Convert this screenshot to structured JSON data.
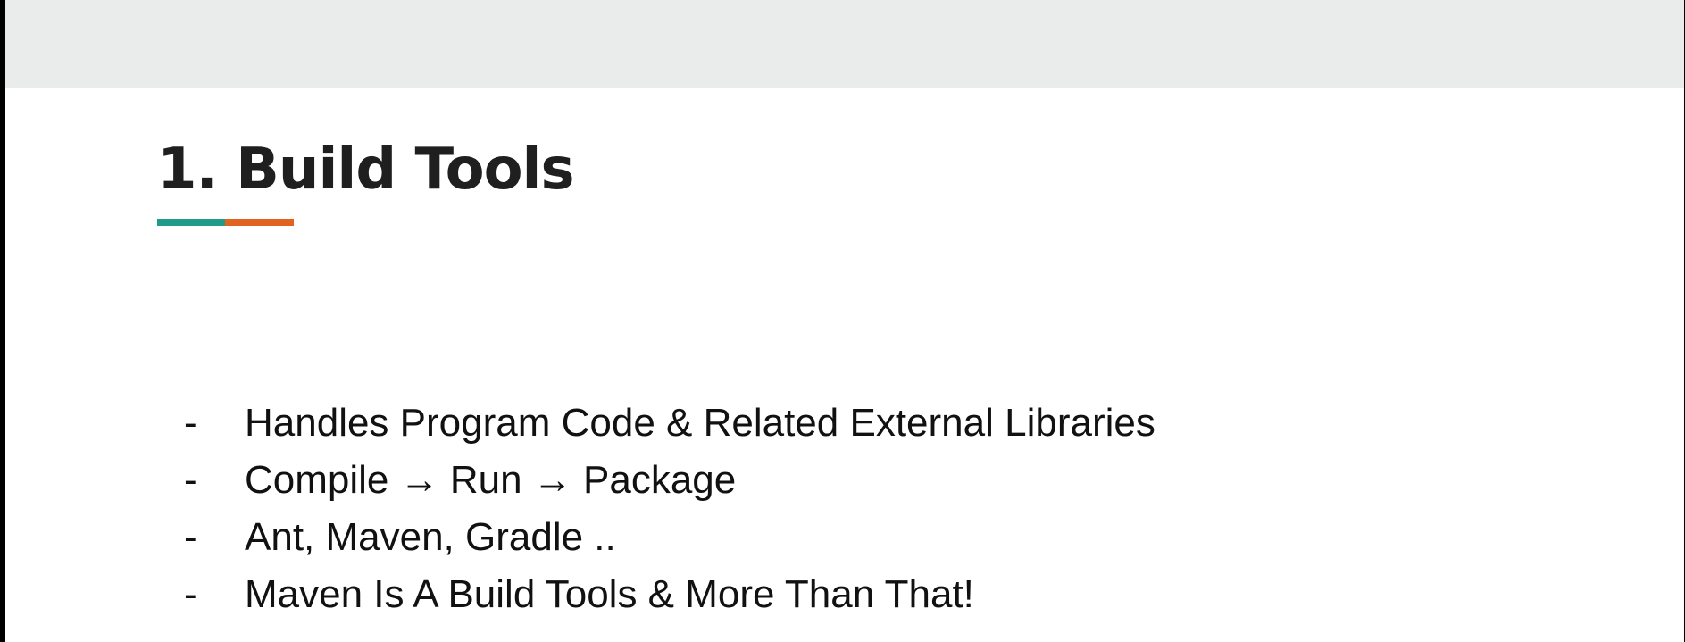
{
  "slide": {
    "title": "1.  Build Tools",
    "accent_colors": [
      "#1f9a8b",
      "#e06420"
    ],
    "bullet_marker": "-",
    "bullets": [
      "Handles Program Code & Related External Libraries",
      "Compile → Run → Package",
      "Ant, Maven, Gradle ..",
      "Maven Is A Build Tools & More Than That!"
    ]
  }
}
